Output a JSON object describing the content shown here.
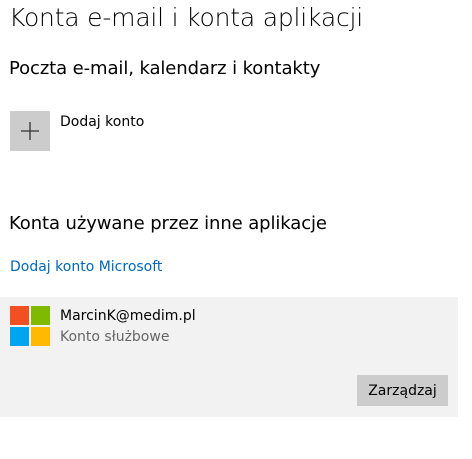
{
  "page": {
    "title": "Konta e-mail i konta aplikacji"
  },
  "email_section": {
    "heading": "Poczta e-mail, kalendarz i kontakty",
    "add_account": {
      "label": "Dodaj konto",
      "icon": "plus-icon"
    }
  },
  "other_apps_section": {
    "heading": "Konta używane przez inne aplikacje",
    "add_microsoft_link": "Dodaj konto Microsoft",
    "accounts": [
      {
        "email": "MarcinK@medim.pl",
        "type": "Konto służbowe",
        "icon": "microsoft-logo-icon",
        "manage_label": "Zarządzaj"
      }
    ]
  },
  "colors": {
    "link": "#0067b8",
    "tile": "#cccccc",
    "panel": "#f2f2f2",
    "ms_red": "#f25022",
    "ms_green": "#7fba00",
    "ms_blue": "#00a4ef",
    "ms_yellow": "#ffb900"
  }
}
